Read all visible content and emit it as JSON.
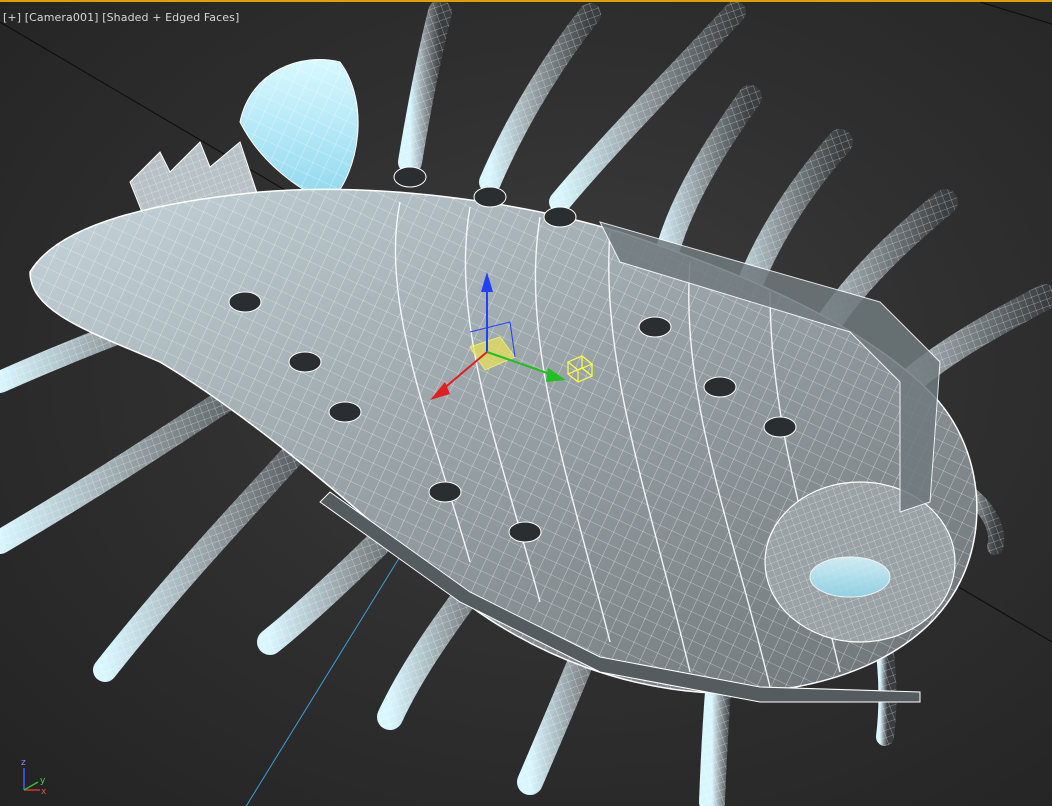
{
  "viewport": {
    "menu_plus": "[+]",
    "camera_label": "[Camera001]",
    "shading_label": "[Shaded + Edged Faces]"
  },
  "tripod": {
    "z": "z",
    "x": "x",
    "y": "y"
  },
  "colors": {
    "active_border": "#e0a000",
    "x_axis": "#e02020",
    "y_axis": "#20c020",
    "z_axis": "#2040ff",
    "mesh_fill": "#a8b2b6",
    "mesh_highlight": "#bfefff",
    "wire": "#ffffff"
  },
  "icons": [
    "move-gizmo-icon",
    "axis-tripod-icon",
    "camera-target-icon"
  ]
}
